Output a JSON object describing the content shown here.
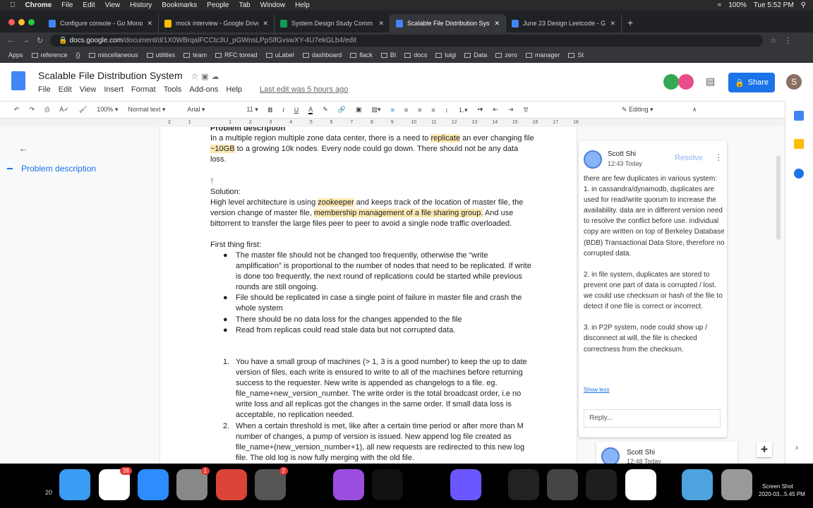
{
  "menubar": {
    "app": "Chrome",
    "items": [
      "File",
      "Edit",
      "View",
      "History",
      "Bookmarks",
      "People",
      "Tab",
      "Window",
      "Help"
    ],
    "battery": "100%",
    "clock": "Tue 5:52 PM"
  },
  "tabs": [
    {
      "title": "Configure console - Go Mono",
      "color": "#4285f4"
    },
    {
      "title": "mock interview - Google Drive",
      "color": "#fbbc04"
    },
    {
      "title": "System Design Study Comm",
      "color": "#0f9d58"
    },
    {
      "title": "Scalable File Distribution Syst",
      "color": "#4285f4",
      "active": true
    },
    {
      "title": "June 23 Design Leetcode - Go",
      "color": "#4285f4"
    }
  ],
  "address": {
    "domain": "docs.google.com",
    "path": "/document/d/1X0WBrqalFCCtc3U_pGWnsLPpSlfGvswXY-4U7ekGLb4/edit"
  },
  "bookmarks": [
    "Apps",
    "reference",
    "{}",
    "miscellaneous",
    "utilities",
    "team",
    "RFC toread",
    "uLabel",
    "dashboard",
    "flack",
    "BI",
    "docs",
    "luigi",
    "Data",
    "zero",
    "manager",
    "St"
  ],
  "doc": {
    "title": "Scalable File Distribution System",
    "menu": [
      "File",
      "Edit",
      "View",
      "Insert",
      "Format",
      "Tools",
      "Add-ons",
      "Help"
    ],
    "last_edit": "Last edit was 5 hours ago",
    "share": "Share",
    "user_initial": "S"
  },
  "toolbar": {
    "zoom": "100%",
    "style": "Normal text",
    "font": "Arial",
    "size": "11",
    "mode": "Editing"
  },
  "ruler": [
    "2",
    "1",
    "1",
    "2",
    "3",
    "4",
    "5",
    "6",
    "7",
    "8",
    "9",
    "10",
    "11",
    "12",
    "13",
    "14",
    "15",
    "16",
    "17",
    "18"
  ],
  "outline": {
    "item": "Problem description"
  },
  "content": {
    "heading": "Problem description",
    "p1a": "In a multiple region multiple zone data center, there is a need to ",
    "p1h": "replicate",
    "p1b": " an ever changing file ",
    "p1h2": "~10GB",
    "p1c": " to a growing 10k nodes. Every node could go down. There should not be any data loss.",
    "solution": "Solution:",
    "p2a": "High level architecture is using ",
    "p2h": "zookeeper",
    "p2b": " and keeps track of the location of master file, the version change of master file, ",
    "p2h2": "membership management of a file sharing group.",
    "p2c": " And use bittorrent to transfer the large files peer to peer to avoid a single node traffic overloaded.",
    "first": "First thing first:",
    "bullets": [
      "The master file should not be changed too frequently, otherwise the “write amplification” is proportional to the number of nodes that need to be replicated. If write is done too frequently, the next round of replications could be started while previous rounds are still ongoing.",
      "File should be replicated in case a single point of failure in master file and crash the whole system",
      "There should be no data loss for the changes appended to the file",
      "Read from replicas could read stale data but not corrupted data."
    ],
    "numbered": [
      "You have a small group of machines (> 1, 3 is a good number) to keep the up to date version of files, each write is ensured to write to all of the machines before returning success to the requester. New write is appended as changelogs to a file. eg. file_name+new_version_number. The write order is the total broadcast order, i.e no write loss and all replicas got the changes in the same order. If small data loss is acceptable, no replication needed.",
      "When a certain threshold is met, like after a certain time period or after more than M number of changes, a pump of version is issued. New append log file created as file_name+(new_version_number+1), all new requests are redirected to this new log file. The old log is now fully merging with the old file."
    ]
  },
  "comment": {
    "author": "Scott Shi",
    "time": "12:43 Today",
    "resolve": "Resolve",
    "body": "there are few duplicates in various system:\n1. in cassandra/dynamodb, duplicates are used for read/write quorum to increase the availability. data are in different version need to resolve the conflict before use. individual copy are written on top of Berkeley Database (BDB) Transactional Data Store, therefore no corrupted data.\n\n2. in file system, duplicates are stored to prevent one part of data is corrupted / lost. we could use checksum or hash of the file to detect if one file is correct or incorrect.\n\n3. in P2P system, node could show up / disconnect at will, the file is checked correctness from the checksum.",
    "show_less": "Show less",
    "reply_placeholder": "Reply...",
    "next_author": "Scott Shi",
    "next_time": "12:48 Today"
  },
  "dock": {
    "items": [
      {
        "name": "finder",
        "color": "#3b9cf5"
      },
      {
        "name": "slack",
        "color": "#fff",
        "badge": "28"
      },
      {
        "name": "zoom",
        "color": "#2d8cff"
      },
      {
        "name": "system-preferences",
        "color": "#888",
        "badge": "1"
      },
      {
        "name": "chrome",
        "color": "#db4437"
      },
      {
        "name": "app-store",
        "color": "#555",
        "badge": "2"
      },
      {
        "name": "pixel",
        "color": "#000"
      },
      {
        "name": "podcasts",
        "color": "#9b4de0"
      },
      {
        "name": "apple-tv",
        "color": "#111"
      },
      {
        "name": "help",
        "color": "#000"
      },
      {
        "name": "goland",
        "color": "#6b57ff"
      },
      {
        "name": "activity-monitor",
        "color": "#222"
      },
      {
        "name": "sublime-text",
        "color": "#444"
      },
      {
        "name": "terminal",
        "color": "#1e1e1e"
      },
      {
        "name": "music",
        "color": "#fff"
      },
      {
        "name": "downloads-folder",
        "color": "#4ca3dd"
      },
      {
        "name": "trash",
        "color": "#999"
      }
    ],
    "left_label": "20",
    "screenshot_label": "Screen Shot",
    "screenshot_date": "2020-03...5.45 PM"
  }
}
